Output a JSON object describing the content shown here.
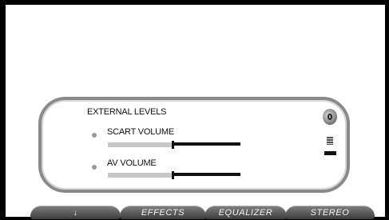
{
  "panel": {
    "title": "EXTERNAL LEVELS",
    "controls": [
      {
        "label": "SCART VOLUME",
        "level": 0.48
      },
      {
        "label": "AV VOLUME",
        "level": 0.48
      }
    ]
  },
  "icons": {
    "speaker": "speaker-icon",
    "meter": "level-meter-icon"
  },
  "tabs": [
    {
      "label": "",
      "glyph": "↓",
      "icon": "down-arrow-icon"
    },
    {
      "label": "EFFECTS"
    },
    {
      "label": "EQUALIZER"
    },
    {
      "label": "STEREO"
    }
  ],
  "colors": {
    "frame": "#000000",
    "panel_border": "#8a8a8a",
    "tab_bg": "#4d4d4d",
    "slider_fill": "#c8c8c8",
    "slider_rest": "#111111"
  }
}
